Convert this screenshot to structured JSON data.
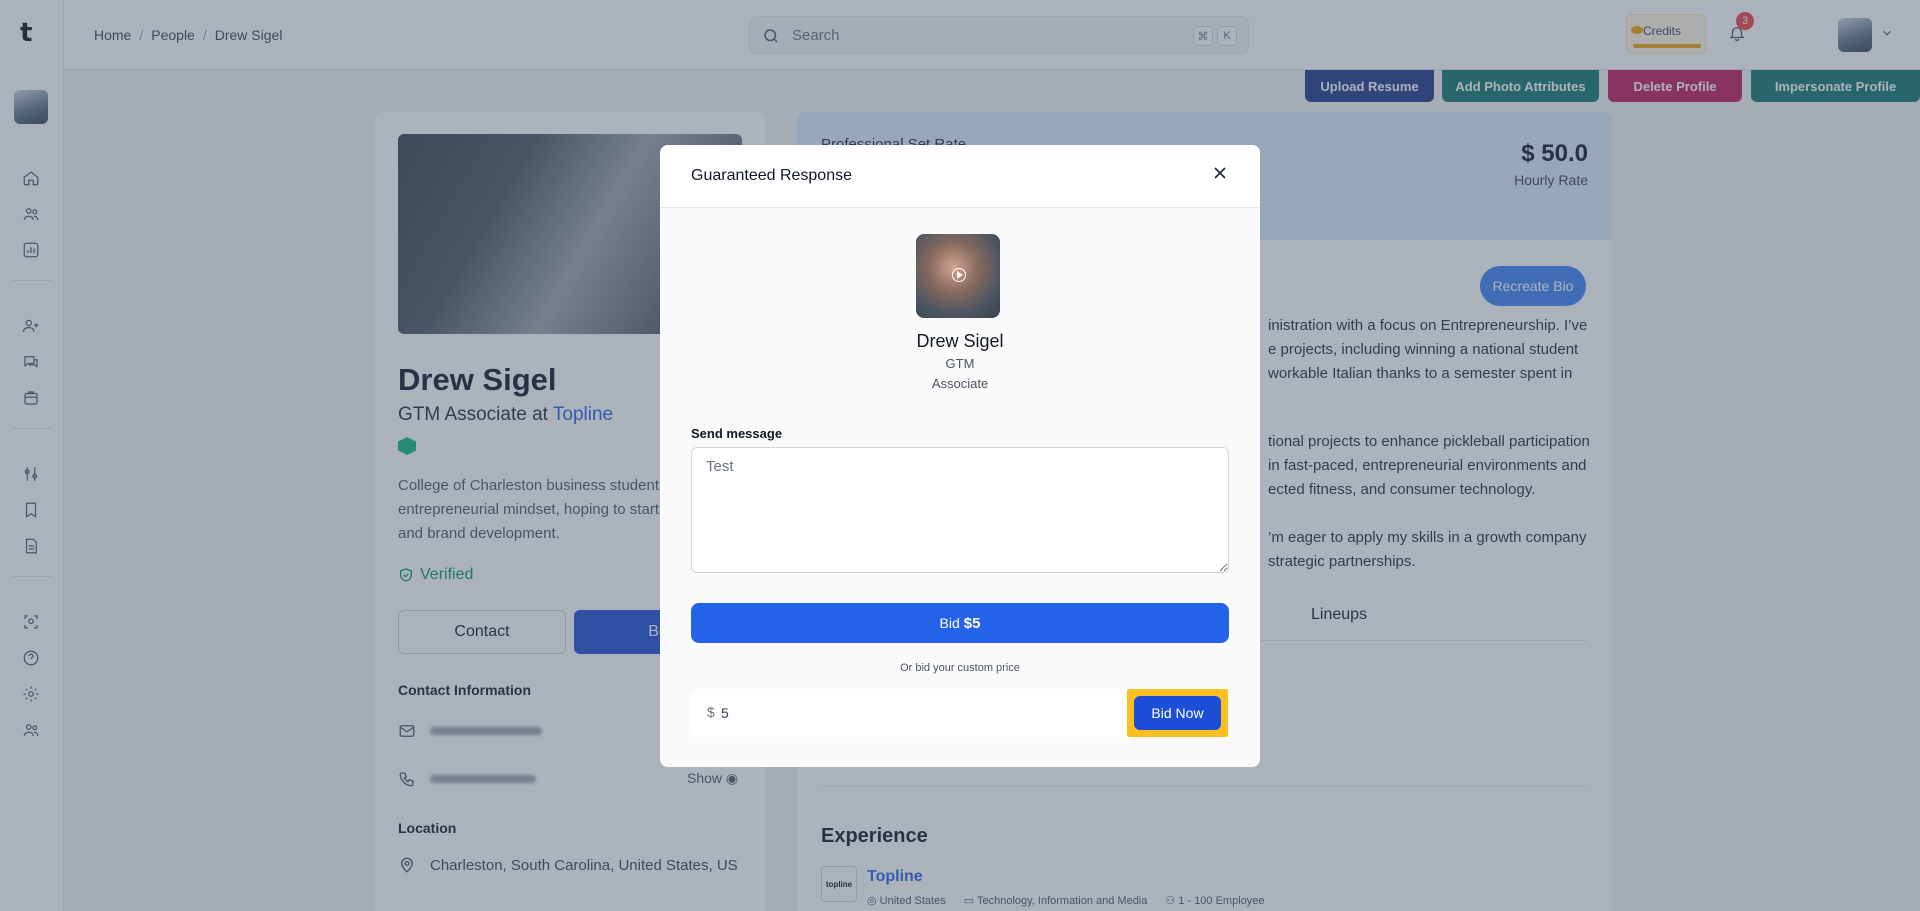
{
  "app": {
    "logo": "t"
  },
  "breadcrumbs": [
    "Home",
    "People",
    "Drew Sigel"
  ],
  "search": {
    "placeholder": "Search",
    "shortcut_mod": "⌘",
    "shortcut_key": "K"
  },
  "header": {
    "credits_label": "Credits",
    "notification_count": "3"
  },
  "actions": {
    "upload_resume": "Upload Resume",
    "add_photo_attributes": "Add Photo Attributes",
    "delete_profile": "Delete Profile",
    "impersonate_profile": "Impersonate Profile"
  },
  "profile": {
    "name": "Drew Sigel",
    "role_prefix": "GTM Associate at ",
    "company": "Topline",
    "bio": "College of Charleston business student entrepreneurial mindset, hoping to start product and brand development.",
    "verified": "Verified",
    "contact_button": "Contact",
    "book_button": "Bo",
    "contact_info_heading": "Contact Information",
    "show_label": "Show",
    "location_heading": "Location",
    "location": "Charleston, South Carolina, United States, US"
  },
  "rate": {
    "label": "Professional Set Rate",
    "value": "$ 50.0",
    "unit": "Hourly Rate"
  },
  "about": {
    "recreate_button": "Recreate Bio",
    "p1_l1": "inistration with a focus on Entrepreneurship. I’ve",
    "p1_l2": "e projects, including winning a national student",
    "p1_l3": "workable Italian thanks to a semester spent in",
    "p2_l1": "tional projects to enhance pickleball participation",
    "p2_l2": "in fast-paced, entrepreneurial environments and",
    "p2_l3": "ected fitness, and consumer technology.",
    "p3_l1": "’m eager to apply my skills in a growth company",
    "p3_l2": "strategic partnerships.",
    "tab_lineups": "Lineups"
  },
  "experience": {
    "heading": "Experience",
    "logo_text": "topline",
    "company": "Topline",
    "country": "United States",
    "industry": "Technology, Information and Media",
    "size": "1 - 100 Employee"
  },
  "modal": {
    "title": "Guaranteed Response",
    "person_name": "Drew Sigel",
    "person_role_line1": "GTM",
    "person_role_line2": "Associate",
    "message_label": "Send message",
    "message_placeholder": "Test",
    "bid_button_prefix": "Bid",
    "bid_button_amount": "$5",
    "custom_hint": "Or bid your custom price",
    "currency_symbol": "$",
    "custom_value": "5",
    "bid_now_button": "Bid Now"
  },
  "colors": {
    "primary": "#2563eb",
    "upload_resume": "#1e3a8a",
    "add_photo_attributes": "#0f766e",
    "delete_profile": "#be185d",
    "impersonate_profile": "#0f766e",
    "highlight": "#fbbf24",
    "verified": "#059669"
  }
}
